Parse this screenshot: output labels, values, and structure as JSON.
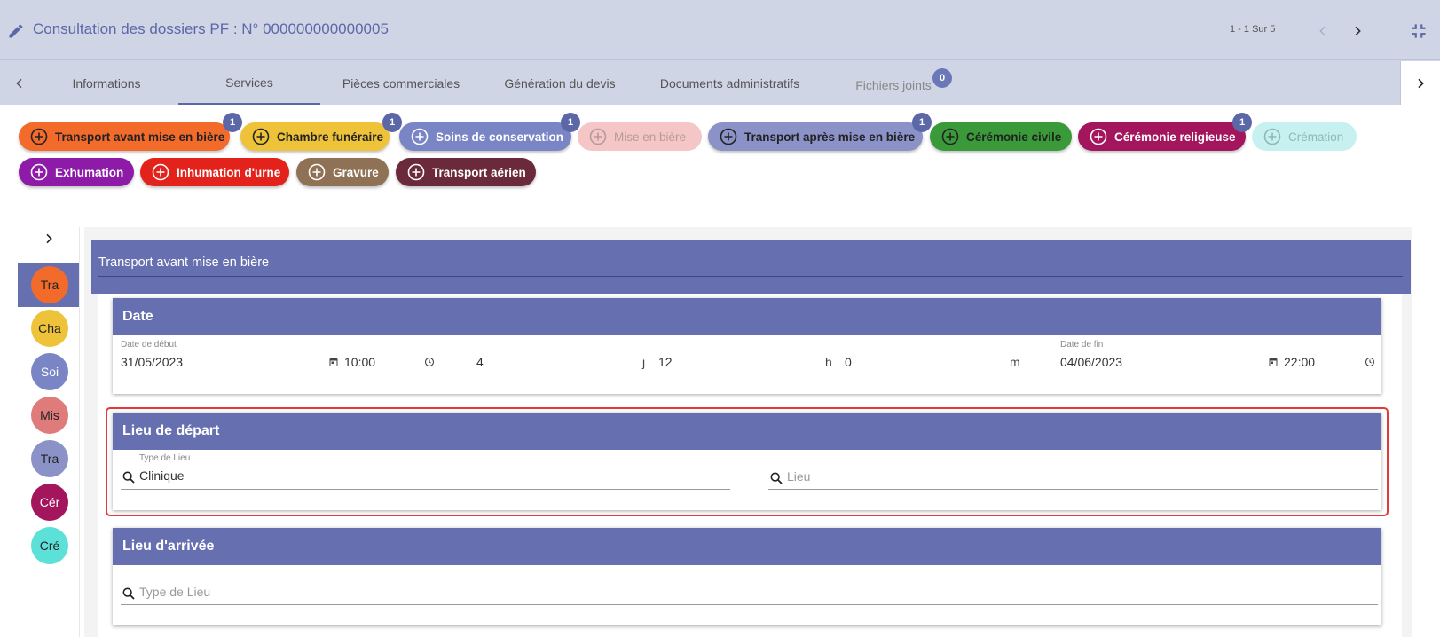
{
  "header": {
    "title": "Consultation des dossiers PF : N° 000000000000005",
    "pager": "1 - 1 Sur 5"
  },
  "tabs": [
    {
      "label": "Informations"
    },
    {
      "label": "Services"
    },
    {
      "label": "Pièces commerciales"
    },
    {
      "label": "Génération du devis"
    },
    {
      "label": "Documents administratifs"
    },
    {
      "label": "Fichiers joints",
      "badge": "0"
    }
  ],
  "services": [
    {
      "label": "Transport avant mise en bière",
      "badge": "1",
      "color": "#f26b2a"
    },
    {
      "label": "Chambre funéraire",
      "badge": "1",
      "color": "#eec33a"
    },
    {
      "label": "Soins de conservation",
      "badge": "1",
      "color": "#7a85c6"
    },
    {
      "label": "Mise en bière",
      "color": "#f4c6c6"
    },
    {
      "label": "Transport après mise en bière",
      "badge": "1",
      "color": "#8a92c8"
    },
    {
      "label": "Cérémonie civile",
      "color": "#3a9a3a"
    },
    {
      "label": "Cérémonie religieuse",
      "badge": "1",
      "color": "#a3155c"
    },
    {
      "label": "Crémation",
      "color": "#c7f1f0"
    },
    {
      "label": "Exhumation",
      "color": "#8e1aa8"
    },
    {
      "label": "Inhumation d'urne",
      "color": "#e3221b"
    },
    {
      "label": "Gravure",
      "color": "#8f7156"
    },
    {
      "label": "Transport aérien",
      "color": "#6b2a3c"
    }
  ],
  "rail": [
    {
      "label": "Tra",
      "color": "#f26b2a"
    },
    {
      "label": "Cha",
      "color": "#eec33a"
    },
    {
      "label": "Soi",
      "color": "#7a85c6"
    },
    {
      "label": "Mis",
      "color": "#e07b7b"
    },
    {
      "label": "Tra",
      "color": "#8a92c8"
    },
    {
      "label": "Cér",
      "color": "#a3155c"
    },
    {
      "label": "Cré",
      "color": "#5ce1d8"
    }
  ],
  "section": {
    "title": "Transport avant mise en bière"
  },
  "date_card": {
    "title": "Date",
    "start_label": "Date de début",
    "start_date": "31/05/2023",
    "start_time": "10:00",
    "days": "4",
    "days_unit": "j",
    "hours": "12",
    "hours_unit": "h",
    "minutes": "0",
    "minutes_unit": "m",
    "end_label": "Date de fin",
    "end_date": "04/06/2023",
    "end_time": "22:00"
  },
  "departure_card": {
    "title": "Lieu de départ",
    "type_label": "Type de Lieu",
    "type_value": "Clinique",
    "place_placeholder": "Lieu"
  },
  "arrival_card": {
    "title": "Lieu d'arrivée",
    "type_placeholder": "Type de Lieu"
  }
}
